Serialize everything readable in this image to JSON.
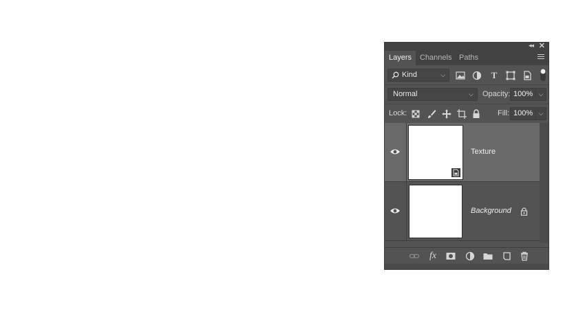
{
  "panel": {
    "tabs": [
      {
        "label": "Layers",
        "active": true
      },
      {
        "label": "Channels",
        "active": false
      },
      {
        "label": "Paths",
        "active": false
      }
    ]
  },
  "filter": {
    "kind_label": "Kind",
    "icons": [
      "image-filter-icon",
      "adjustment-filter-icon",
      "type-filter-icon",
      "shape-filter-icon",
      "smart-object-filter-icon",
      "filter-toggle-icon"
    ]
  },
  "blend": {
    "mode": "Normal",
    "opacity_label": "Opacity:",
    "opacity_value": "100%"
  },
  "lock": {
    "label": "Lock:",
    "icons": [
      "lock-transparent-pixels-icon",
      "lock-image-pixels-icon",
      "lock-position-icon",
      "lock-artboard-icon",
      "lock-all-icon"
    ],
    "fill_label": "Fill:",
    "fill_value": "100%"
  },
  "layers": [
    {
      "name": "Texture",
      "selected": true,
      "smart_object": true,
      "visible": true
    },
    {
      "name": "Background",
      "selected": false,
      "locked": true,
      "italic": true,
      "visible": true
    }
  ],
  "bottom_icons": [
    "link-layers-icon",
    "fx-icon",
    "add-mask-icon",
    "new-adjustment-layer-icon",
    "new-group-icon",
    "new-layer-icon",
    "delete-layer-icon"
  ],
  "colors": {
    "panel_bg": "#535353",
    "selected_layer": "#696969"
  }
}
